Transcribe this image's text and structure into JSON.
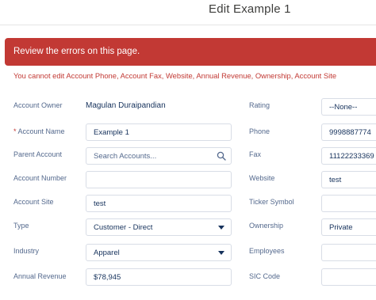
{
  "header": {
    "title": "Edit Example 1"
  },
  "errors": {
    "banner": "Review the errors on this page.",
    "detail": "You cannot edit Account Phone, Account Fax, Website, Annual Revenue, Ownership, Account Site"
  },
  "left_fields": [
    {
      "label": "Account Owner",
      "value": "Magulan Duraipandian",
      "kind": "static"
    },
    {
      "label": "Account Name",
      "value": "Example 1",
      "kind": "text",
      "required": true
    },
    {
      "label": "Parent Account",
      "placeholder": "Search Accounts...",
      "kind": "lookup"
    },
    {
      "label": "Account Number",
      "value": "",
      "kind": "text"
    },
    {
      "label": "Account Site",
      "value": "test",
      "kind": "text"
    },
    {
      "label": "Type",
      "value": "Customer - Direct",
      "kind": "select"
    },
    {
      "label": "Industry",
      "value": "Apparel",
      "kind": "select"
    },
    {
      "label": "Annual Revenue",
      "value": "$78,945",
      "kind": "text"
    }
  ],
  "right_fields": [
    {
      "label": "Rating",
      "value": "--None--",
      "kind": "select"
    },
    {
      "label": "Phone",
      "value": "9998887774",
      "kind": "text"
    },
    {
      "label": "Fax",
      "value": "11122233369",
      "kind": "text"
    },
    {
      "label": "Website",
      "value": "test",
      "kind": "text"
    },
    {
      "label": "Ticker Symbol",
      "value": "",
      "kind": "text"
    },
    {
      "label": "Ownership",
      "value": "Private",
      "kind": "select"
    },
    {
      "label": "Employees",
      "value": "",
      "kind": "text"
    },
    {
      "label": "SIC Code",
      "value": "",
      "kind": "text"
    }
  ],
  "icons": {
    "lookup": "search-icon",
    "select": "chevron-down-icon"
  },
  "colors": {
    "error": "#c23934",
    "label": "#54698d",
    "text": "#16325c",
    "border": "#d8dde6"
  }
}
